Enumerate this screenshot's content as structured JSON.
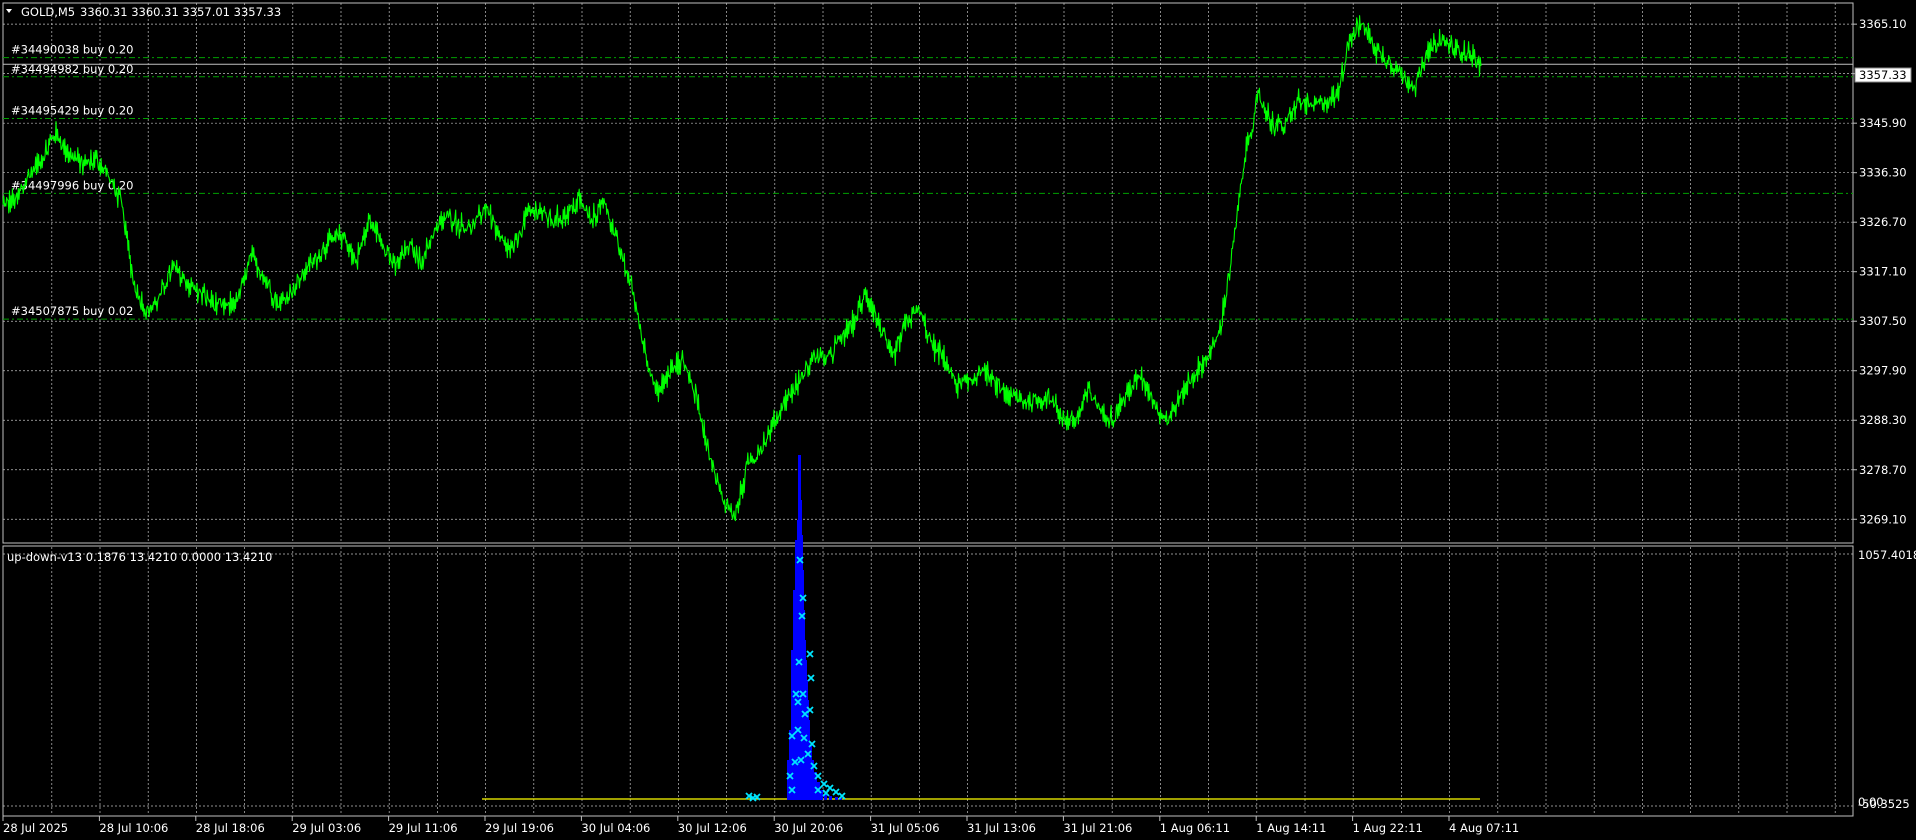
{
  "header": {
    "symbol_label": "GOLD,M5",
    "ohlc": "3360.31 3360.31 3357.01 3357.33"
  },
  "price_axis": {
    "ticks": [
      "3365.10",
      "3355.50",
      "3345.90",
      "3336.30",
      "3326.70",
      "3317.10",
      "3307.50",
      "3297.90",
      "3288.30",
      "3278.70",
      "3269.10"
    ],
    "current_price": "3357.33"
  },
  "orders": [
    {
      "label": "#34490038 buy 0.20",
      "price": 3358.6
    },
    {
      "label": "#34494982 buy 0.20",
      "price": 3354.9
    },
    {
      "label": "#34495429 buy 0.20",
      "price": 3346.8
    },
    {
      "label": "#34497996 buy 0.20",
      "price": 3332.3
    },
    {
      "label": "#34507875 buy 0.02",
      "price": 3307.9
    }
  ],
  "indicator": {
    "label": "up-down-v13 0.1876 13.4210 0.0000 13.4210",
    "axis_top": "1057.4018",
    "axis_zero": "0.00",
    "axis_bottom": "-50.3525"
  },
  "time_axis": {
    "labels": [
      "28 Jul 2025",
      "28 Jul 10:06",
      "28 Jul 18:06",
      "29 Jul 03:06",
      "29 Jul 11:06",
      "29 Jul 19:06",
      "30 Jul 04:06",
      "30 Jul 12:06",
      "30 Jul 20:06",
      "31 Jul 05:06",
      "31 Jul 13:06",
      "31 Jul 21:06",
      "1 Aug 06:11",
      "1 Aug 14:11",
      "1 Aug 22:11",
      "4 Aug 07:11"
    ]
  },
  "colors": {
    "background": "#000000",
    "price_line": "#00ff00",
    "order_line": "#00a000",
    "grid": "#c0c0c0",
    "histogram": "#0000ff",
    "markers": "#00e5ff",
    "zero_line": "#ffff00"
  },
  "chart_data": {
    "type": "line",
    "series": [
      {
        "values": [
          3330,
          3331,
          3336,
          3339,
          3344,
          3340,
          3338,
          3339,
          3336,
          3331,
          3315,
          3309,
          3312,
          3318,
          3315,
          3313,
          3311,
          3310,
          3312,
          3320,
          3316,
          3311,
          3313,
          3317,
          3320,
          3323,
          3324,
          3319,
          3327,
          3323,
          3318,
          3322,
          3319,
          3325,
          3328,
          3326,
          3326,
          3330,
          3323,
          3321,
          3328,
          3329,
          3327,
          3328,
          3331,
          3327,
          3331,
          3322,
          3315,
          3303,
          3293,
          3298,
          3300,
          3293,
          3282,
          3273,
          3270,
          3280,
          3283,
          3288,
          3293,
          3296,
          3301,
          3300,
          3304,
          3307,
          3313,
          3307,
          3300,
          3307,
          3310,
          3303,
          3300,
          3295,
          3296,
          3298,
          3295,
          3293,
          3292,
          3292,
          3293,
          3289,
          3288,
          3294,
          3290,
          3289,
          3294,
          3297,
          3292,
          3288,
          3293,
          3297,
          3300,
          3305,
          3321,
          3340,
          3351,
          3346,
          3345,
          3350,
          3349,
          3350,
          3351,
          3363,
          3365,
          3360,
          3358,
          3355,
          3353,
          3360,
          3362,
          3360,
          3360,
          3357
        ]
      }
    ],
    "ylim": [
      3264.5,
      3369.2
    ]
  }
}
